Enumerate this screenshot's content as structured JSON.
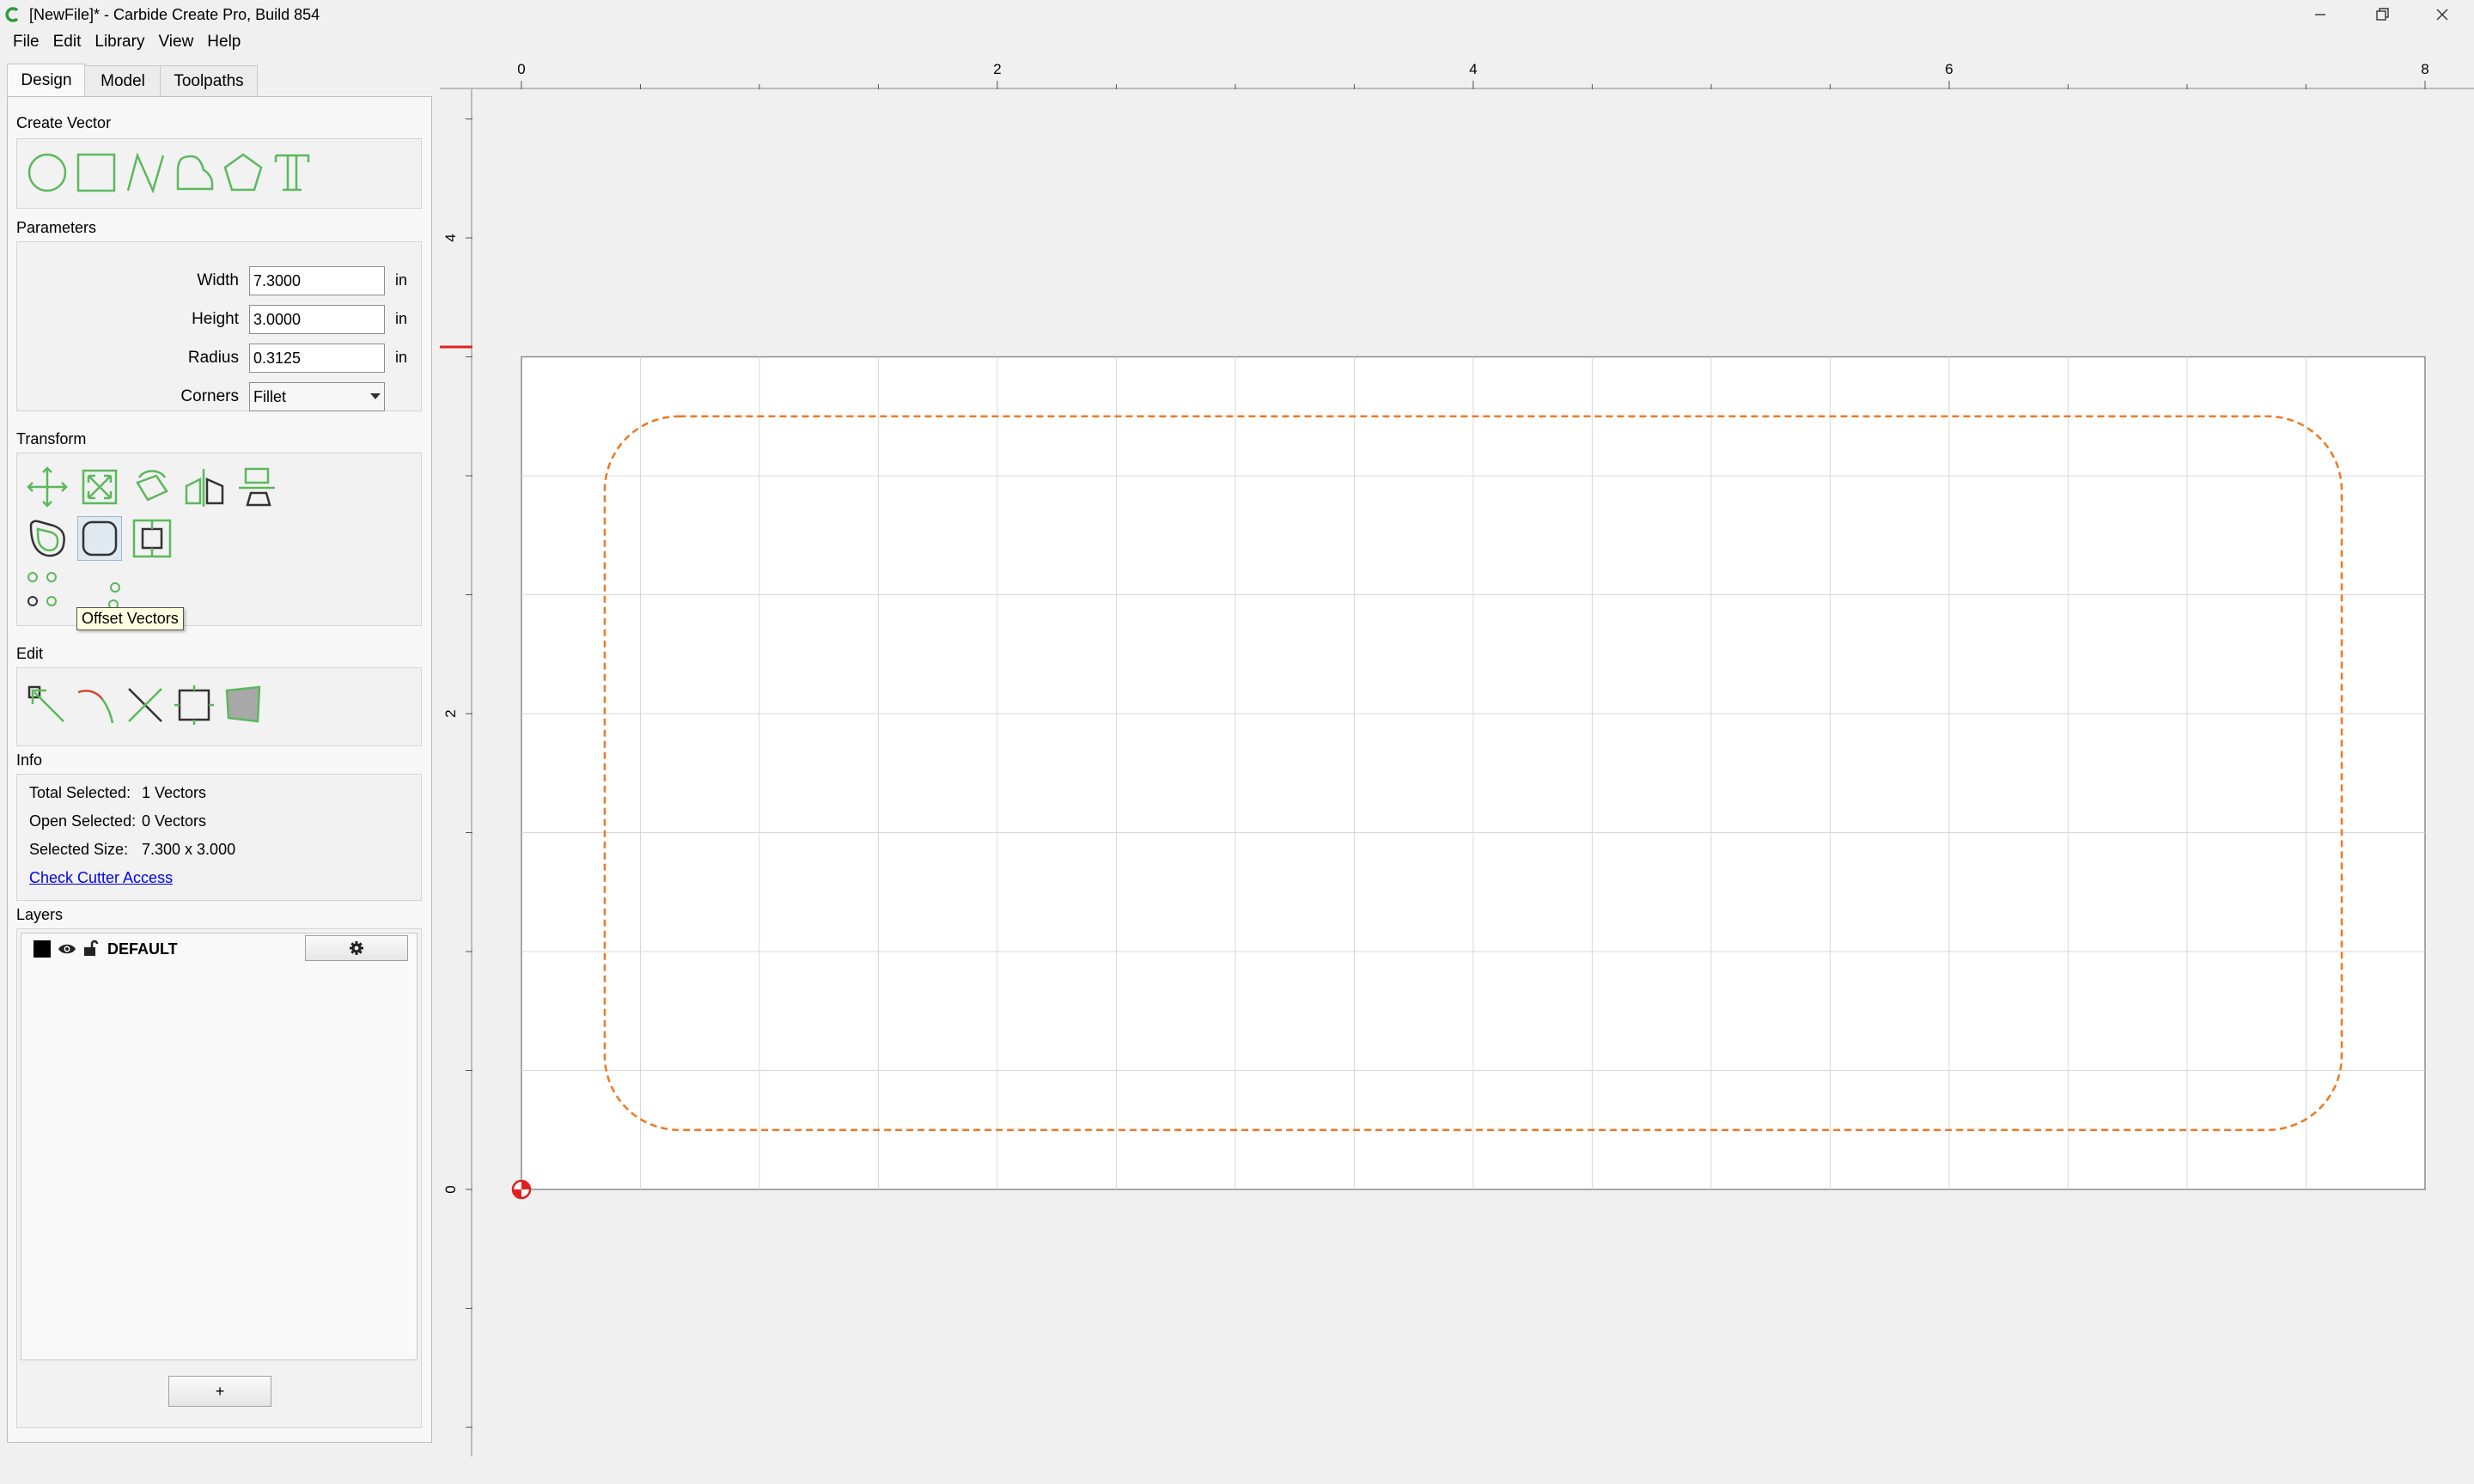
{
  "window": {
    "title": "[NewFile]* - Carbide Create Pro, Build 854",
    "controls": [
      "minimize",
      "restore",
      "close"
    ]
  },
  "menu": [
    "File",
    "Edit",
    "Library",
    "View",
    "Help"
  ],
  "tabs": [
    {
      "label": "Design",
      "active": true
    },
    {
      "label": "Model",
      "active": false
    },
    {
      "label": "Toolpaths",
      "active": false
    }
  ],
  "create_vector": {
    "label": "Create Vector",
    "tools": [
      "circle-icon",
      "rectangle-icon",
      "polyline-icon",
      "curve-icon",
      "polygon-icon",
      "text-icon"
    ]
  },
  "parameters": {
    "label": "Parameters",
    "width_label": "Width",
    "width_value": "7.3000",
    "height_label": "Height",
    "height_value": "3.0000",
    "radius_label": "Radius",
    "radius_value": "0.3125",
    "unit": "in",
    "corners_label": "Corners",
    "corners_value": "Fillet"
  },
  "transform": {
    "label": "Transform",
    "tooltip": "Offset Vectors",
    "tools": [
      "move-icon",
      "scale-icon",
      "rotate-icon",
      "mirror-icon",
      "align-icon",
      "offset-icon",
      "fillet-icon",
      "boolean-icon",
      "array-icon"
    ]
  },
  "edit": {
    "label": "Edit",
    "tools": [
      "node-edit-icon",
      "smooth-icon",
      "trim-icon",
      "join-icon",
      "fill-icon"
    ]
  },
  "info": {
    "label": "Info",
    "total_selected_label": "Total Selected:",
    "total_selected_value": "1 Vectors",
    "open_selected_label": "Open Selected:",
    "open_selected_value": "0 Vectors",
    "selected_size_label": "Selected Size:",
    "selected_size_value": "7.300 x 3.000",
    "check_link": "Check Cutter Access"
  },
  "layers": {
    "label": "Layers",
    "items": [
      {
        "name": "DEFAULT",
        "color": "#000000"
      }
    ],
    "add_label": "+"
  },
  "canvas": {
    "ruler_top_labels": [
      "0",
      "2",
      "4",
      "6",
      "8"
    ],
    "ruler_left_labels": [
      "4",
      "2",
      "0"
    ],
    "stock_width_in": 8,
    "stock_height_in": 3.5,
    "grid_in": 0.5,
    "shape": {
      "type": "rounded-rectangle",
      "width_in": 7.3,
      "height_in": 3.0,
      "radius_in": 0.3125
    },
    "selection_color": "#f07820"
  }
}
